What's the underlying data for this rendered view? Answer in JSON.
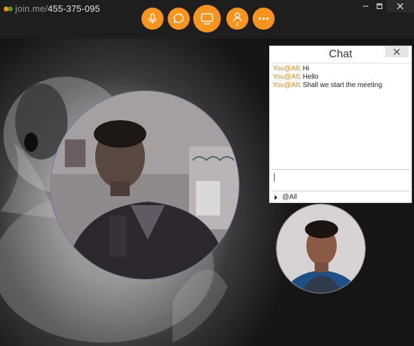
{
  "window": {
    "title_prefix": "join.me/",
    "meeting_code": "455-375-095",
    "controls": [
      "minimize-icon",
      "maximize-icon",
      "close-icon"
    ]
  },
  "toolbar": {
    "buttons": [
      {
        "name": "microphone-button",
        "icon": "microphone-icon"
      },
      {
        "name": "chat-button",
        "icon": "chat-bubble-icon"
      },
      {
        "name": "screen-share-button",
        "icon": "monitor-icon"
      },
      {
        "name": "participants-button",
        "icon": "person-icon",
        "count": "2"
      },
      {
        "name": "more-button",
        "icon": "more-dots-icon"
      }
    ],
    "accent": "#f7941d"
  },
  "chat": {
    "title": "Chat",
    "messages": [
      {
        "sender": "You@All",
        "separator": ": ",
        "text": "Hi"
      },
      {
        "sender": "You@All",
        "separator": ": ",
        "text": "Hello"
      },
      {
        "sender": "You@All",
        "separator": ": ",
        "text": "Shall we start the meeting"
      }
    ],
    "input_value": "",
    "recipient": "@All",
    "sender_color": "#e28a17"
  }
}
